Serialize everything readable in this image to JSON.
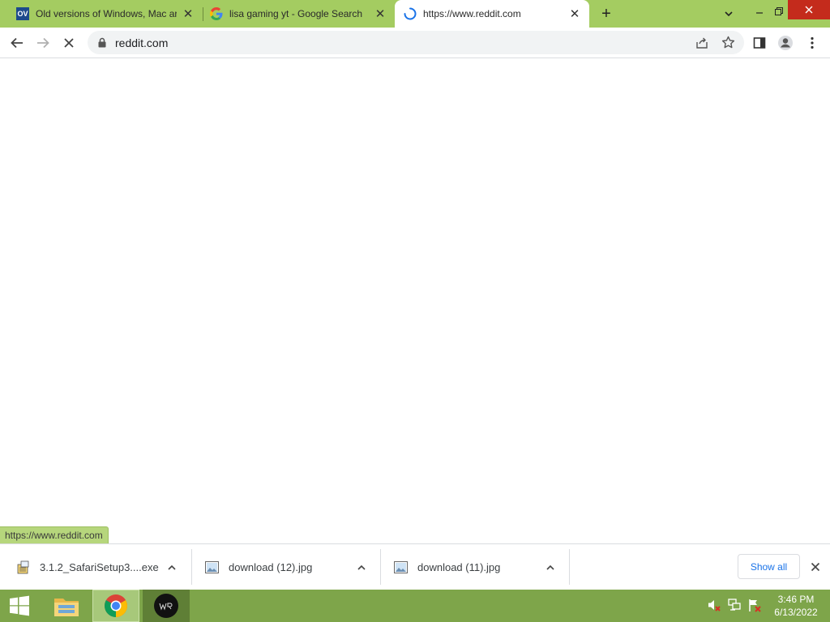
{
  "tabs": [
    {
      "title": "Old versions of Windows, Mac ar",
      "favicon": "ov-icon",
      "favicon_text": "OV"
    },
    {
      "title": "lisa gaming yt - Google Search",
      "favicon": "google-icon"
    },
    {
      "title": "https://www.reddit.com",
      "favicon": "loading-spinner-icon",
      "active": true
    }
  ],
  "toolbar": {
    "url": "reddit.com"
  },
  "status_bar": {
    "text": "https://www.reddit.com"
  },
  "downloads": {
    "items": [
      {
        "name": "3.1.2_SafariSetup3....exe",
        "icon": "installer-icon"
      },
      {
        "name": "download (12).jpg",
        "icon": "image-file-icon"
      },
      {
        "name": "download (11).jpg",
        "icon": "image-file-icon"
      }
    ],
    "show_all_label": "Show all"
  },
  "taskbar": {
    "time": "3:46 PM",
    "date": "6/13/2022"
  },
  "colors": {
    "tab_strip": "#a4cc61",
    "taskbar": "#7ea54a",
    "link_blue": "#1a73e8"
  }
}
